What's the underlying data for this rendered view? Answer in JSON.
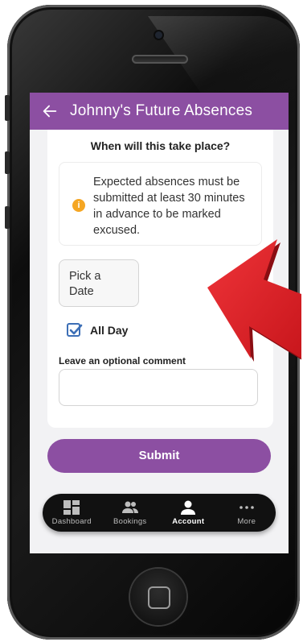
{
  "app_bar": {
    "title": "Johnny's Future Absences"
  },
  "form": {
    "when_heading": "When will this take place?",
    "notice_text": "Expected absences must be submitted at least 30 minutes in advance to be marked excused.",
    "date_button_label": "Pick a Date",
    "all_day_label": "All Day",
    "all_day_checked": true,
    "comment_label": "Leave an optional comment",
    "comment_value": ""
  },
  "submit_label": "Submit",
  "tabs": [
    {
      "label": "Dashboard",
      "icon": "dashboard-icon",
      "active": false
    },
    {
      "label": "Bookings",
      "icon": "people-icon",
      "active": false
    },
    {
      "label": "Account",
      "icon": "person-icon",
      "active": true
    },
    {
      "label": "More",
      "icon": "more-dots-icon",
      "active": false
    }
  ],
  "colors": {
    "primary": "#8c4fa2",
    "info": "#f5a623",
    "checkbox": "#3d6fb6",
    "arrow": "#e2262b"
  }
}
